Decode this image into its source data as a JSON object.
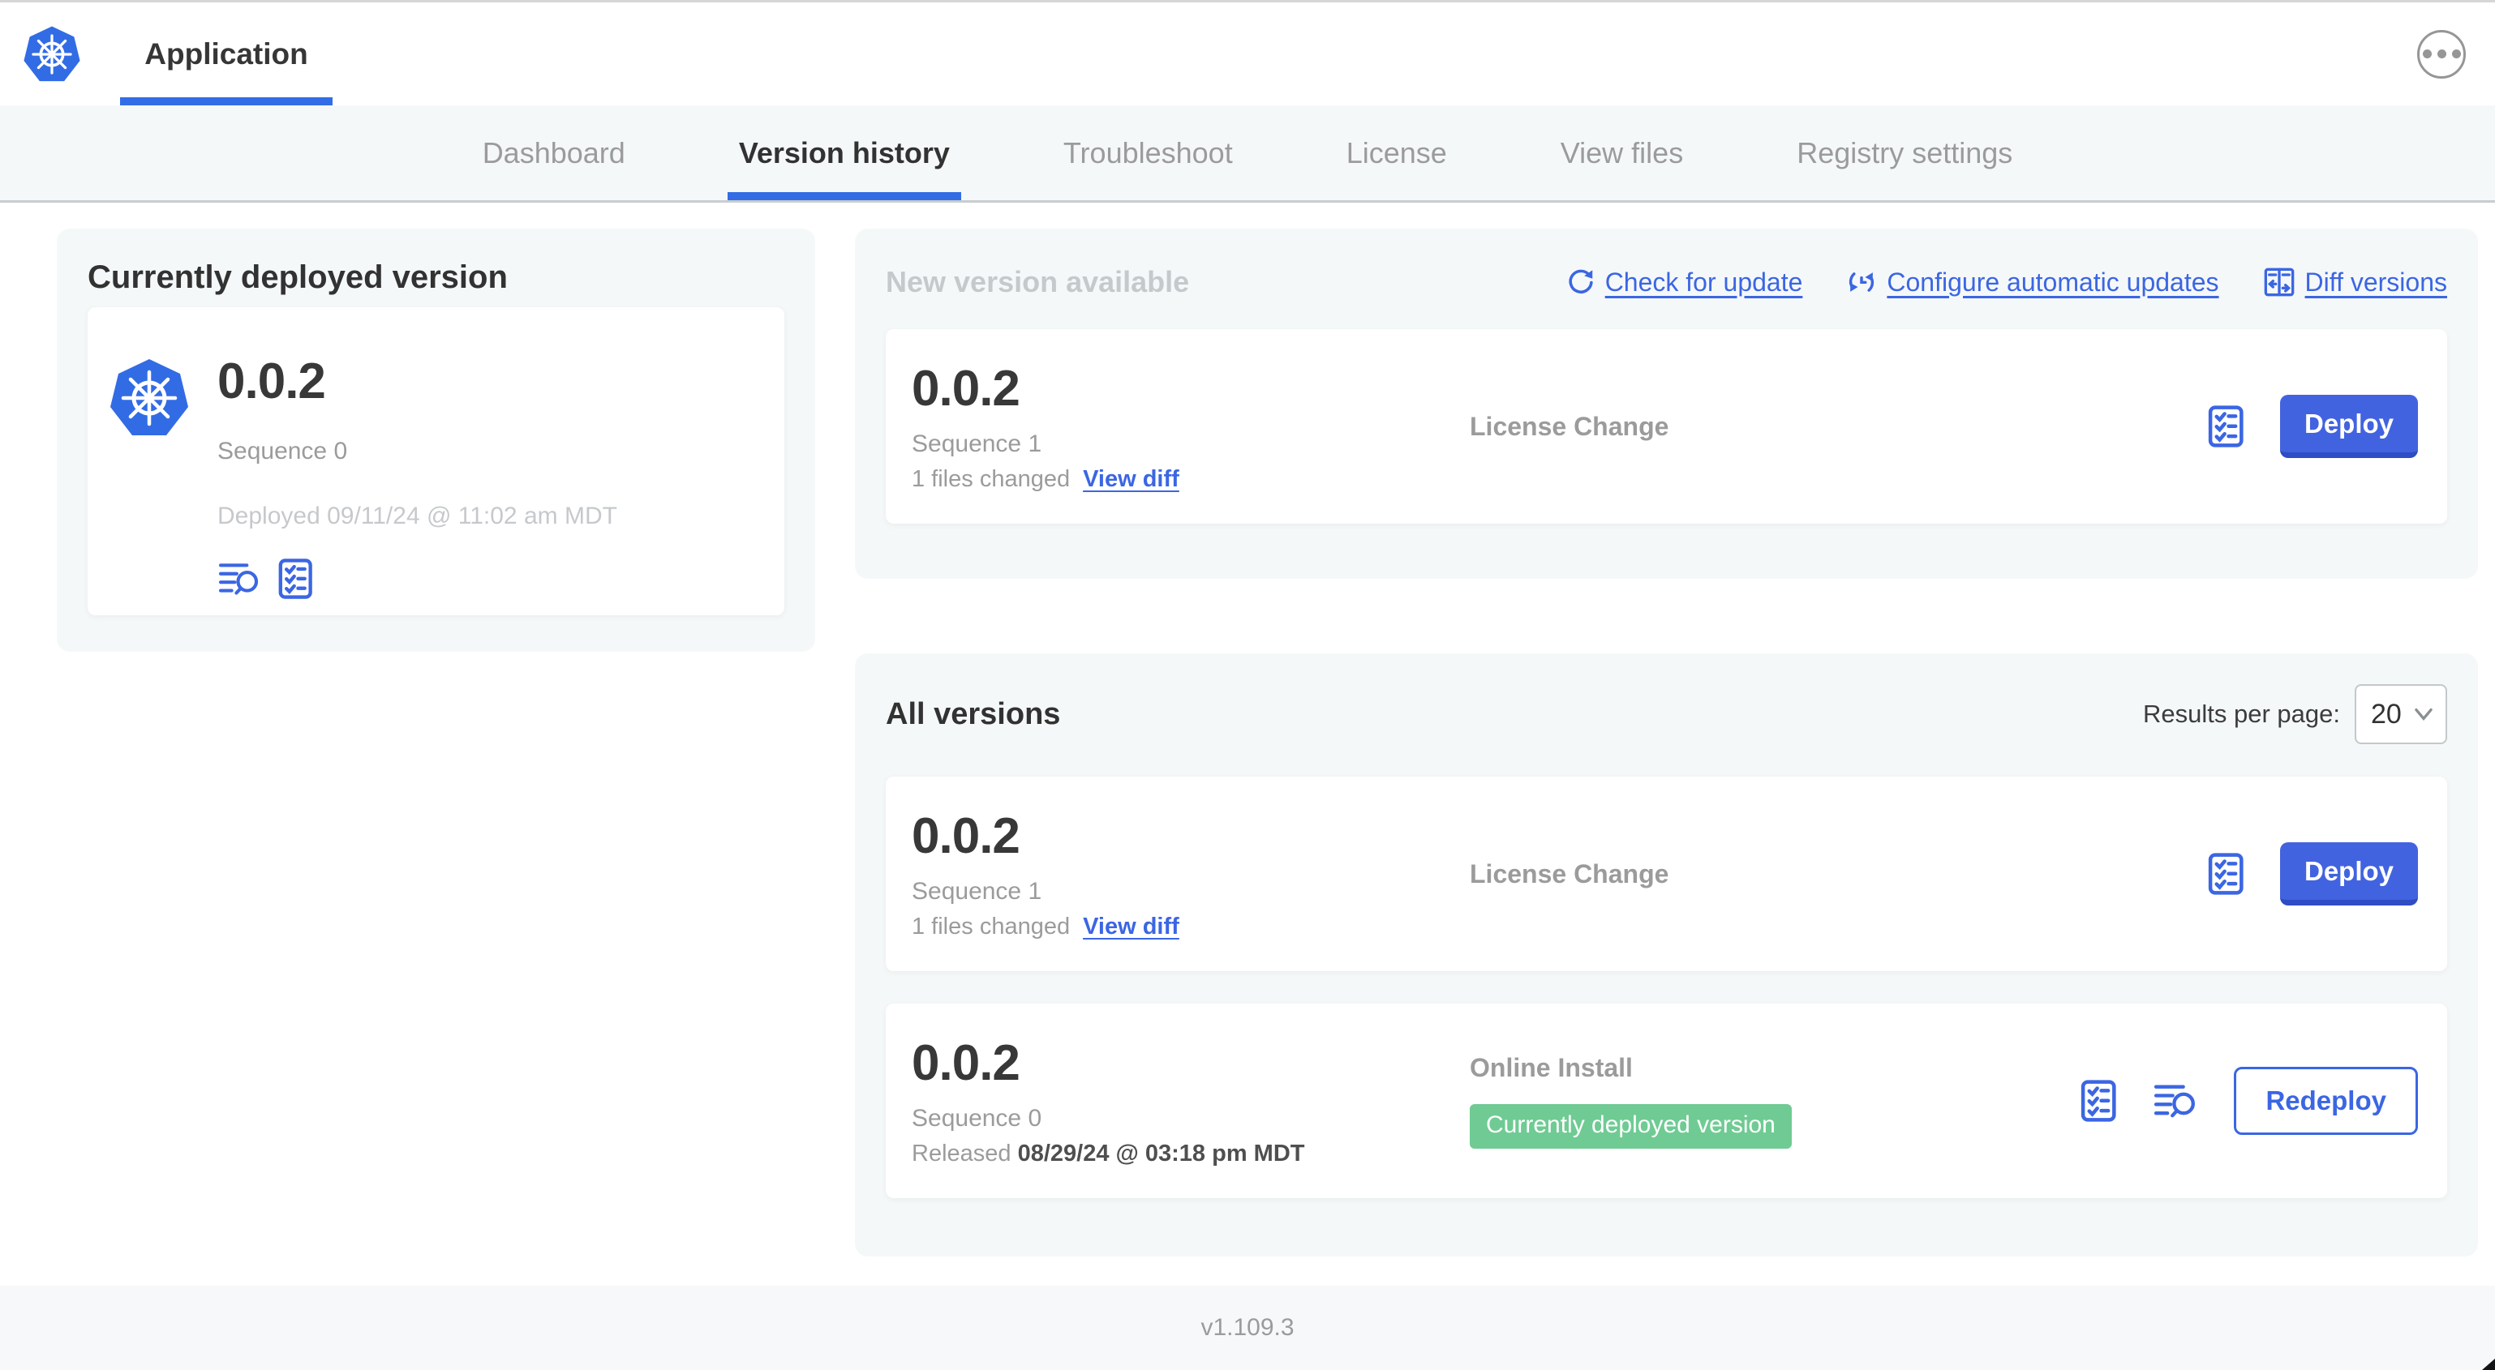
{
  "header": {
    "app_title": "Application"
  },
  "nav": {
    "tabs": [
      "Dashboard",
      "Version history",
      "Troubleshoot",
      "License",
      "View files",
      "Registry settings"
    ],
    "active_index": 1
  },
  "current": {
    "title": "Currently deployed version",
    "version": "0.0.2",
    "sequence": "Sequence 0",
    "deployed": "Deployed 09/11/24 @ 11:02 am MDT"
  },
  "new_version": {
    "title": "New version available",
    "actions": [
      {
        "label": "Check for update",
        "icon": "refresh-icon"
      },
      {
        "label": "Configure automatic updates",
        "icon": "auto-update-icon"
      },
      {
        "label": "Diff versions",
        "icon": "diff-icon"
      }
    ],
    "row": {
      "version": "0.0.2",
      "sequence": "Sequence 1",
      "files_changed": "1 files changed",
      "view_diff_label": "View diff",
      "source": "License Change",
      "action_label": "Deploy"
    }
  },
  "all_versions": {
    "title": "All versions",
    "results_per_page_label": "Results per page:",
    "page_size": "20",
    "rows": [
      {
        "version": "0.0.2",
        "sequence": "Sequence 1",
        "files_changed": "1 files changed",
        "view_diff_label": "View diff",
        "source": "License Change",
        "action_label": "Deploy"
      },
      {
        "version": "0.0.2",
        "sequence": "Sequence 0",
        "released_label": "Released",
        "released_date": "08/29/24 @ 03:18 pm MDT",
        "source": "Online Install",
        "badge": "Currently deployed version",
        "action_label": "Redeploy"
      }
    ]
  },
  "footer": {
    "version": "v1.109.3"
  },
  "colors": {
    "accent_blue": "#326DE6",
    "link_blue": "#3B66E3",
    "button_blue": "#4263E0",
    "badge_green": "#6FCB93",
    "panel_bg": "#F5F8F9"
  }
}
